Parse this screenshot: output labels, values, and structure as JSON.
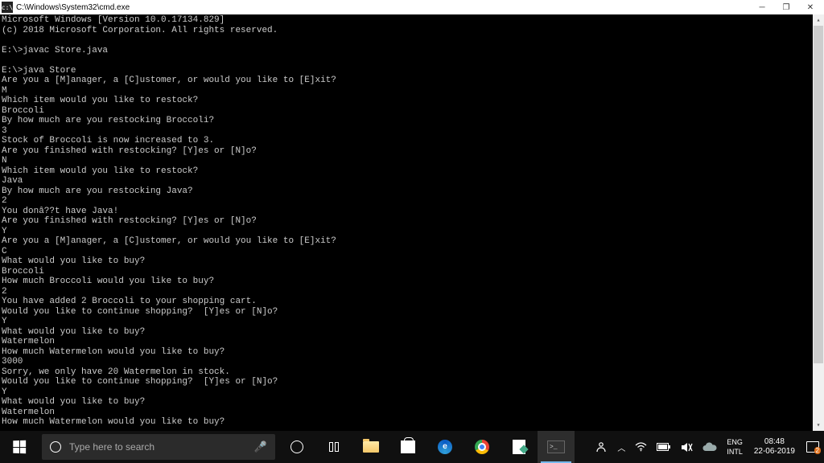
{
  "window": {
    "title": "C:\\Windows\\System32\\cmd.exe",
    "icon_label": "cmd"
  },
  "terminal": {
    "lines": [
      "Microsoft Windows [Version 10.0.17134.829]",
      "(c) 2018 Microsoft Corporation. All rights reserved.",
      "",
      "E:\\>javac Store.java",
      "",
      "E:\\>java Store",
      "Are you a [M]anager, a [C]ustomer, or would you like to [E]xit?",
      "M",
      "Which item would you like to restock?",
      "Broccoli",
      "By how much are you restocking Broccoli?",
      "3",
      "Stock of Broccoli is now increased to 3.",
      "Are you finished with restocking? [Y]es or [N]o?",
      "N",
      "Which item would you like to restock?",
      "Java",
      "By how much are you restocking Java?",
      "2",
      "You donâ??t have Java!",
      "Are you finished with restocking? [Y]es or [N]o?",
      "Y",
      "Are you a [M]anager, a [C]ustomer, or would you like to [E]xit?",
      "C",
      "What would you like to buy?",
      "Broccoli",
      "How much Broccoli would you like to buy?",
      "2",
      "You have added 2 Broccoli to your shopping cart.",
      "Would you like to continue shopping?  [Y]es or [N]o?",
      "Y",
      "What would you like to buy?",
      "Watermelon",
      "How much Watermelon would you like to buy?",
      "3000",
      "Sorry, we only have 20 Watermelon in stock.",
      "Would you like to continue shopping?  [Y]es or [N]o?",
      "Y",
      "What would you like to buy?",
      "Watermelon",
      "How much Watermelon would you like to buy?"
    ]
  },
  "taskbar": {
    "search_placeholder": "Type here to search",
    "lang_top": "ENG",
    "lang_bottom": "INTL",
    "time": "08:48",
    "date": "22-06-2019",
    "notif_count": "2"
  }
}
